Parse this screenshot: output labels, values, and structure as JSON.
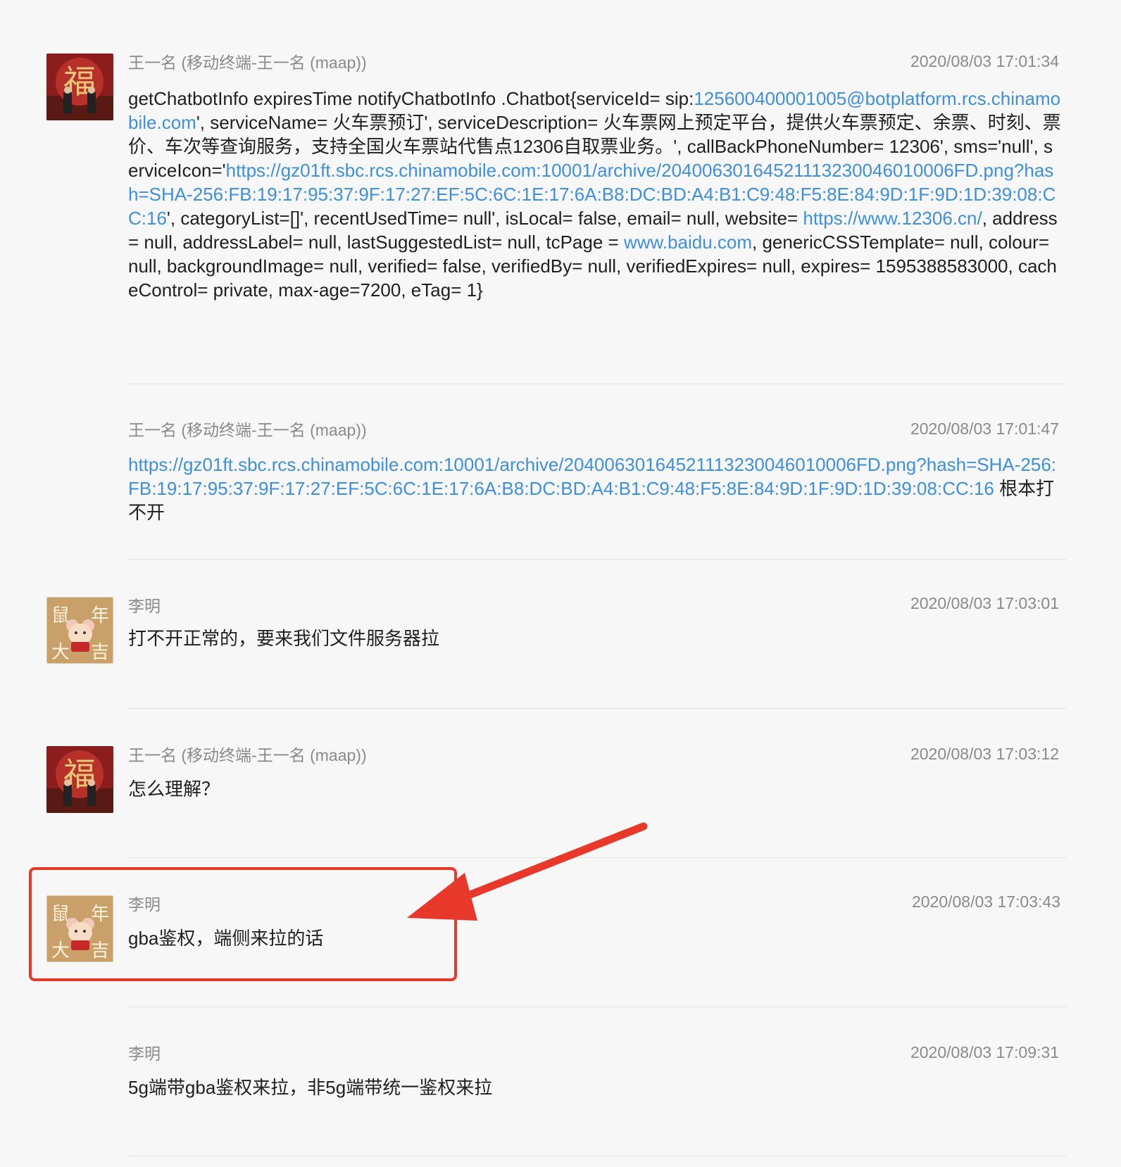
{
  "messages": [
    {
      "sender": "王一名 (移动终端-王一名 (maap))",
      "time": "2020/08/03 17:01:34",
      "avatar": "fu-avatar",
      "segments": [
        {
          "text": " getChatbotInfo  expiresTime notifyChatbotInfo .Chatbot{serviceId= sip:",
          "link": false
        },
        {
          "text": "125600400001005@botplatform.rcs.chinamobile.com",
          "link": true
        },
        {
          "text": "', serviceName= 火车票预订', serviceDescription= 火车票网上预定平台，提供火车票预定、余票、时刻、票价、车次等查询服务，支持全国火车票站代售点12306自取票业务。', callBackPhoneNumber= 12306', sms='null', serviceIcon='",
          "link": false
        },
        {
          "text": "https://gz01ft.sbc.rcs.chinamobile.com:10001/archive/20400630164521113230046010006FD.png?hash=SHA-256:FB:19:17:95:37:9F:17:27:EF:5C:6C:1E:17:6A:B8:DC:BD:A4:B1:C9:48:F5:8E:84:9D:1F:9D:1D:39:08:CC:16",
          "link": true
        },
        {
          "text": "', categoryList=[]', recentUsedTime= null', isLocal= false, email= null, website= ",
          "link": false
        },
        {
          "text": "https://www.12306.cn/",
          "link": true
        },
        {
          "text": ", address= null, addressLabel= null, lastSuggestedList= null, tcPage = ",
          "link": false
        },
        {
          "text": "www.baidu.com",
          "link": true
        },
        {
          "text": ", genericCSSTemplate= null, colour= null, backgroundImage= null, verified= false, verifiedBy= null, verifiedExpires= null, expires= 1595388583000, cacheControl= private, max-age=7200, eTag= 1}",
          "link": false
        }
      ]
    },
    {
      "sender": "王一名 (移动终端-王一名 (maap))",
      "time": "2020/08/03 17:01:47",
      "avatar": "",
      "segments": [
        {
          "text": "https://gz01ft.sbc.rcs.chinamobile.com:10001/archive/20400630164521113230046010006FD.png?hash=SHA-256:FB:19:17:95:37:9F:17:27:EF:5C:6C:1E:17:6A:B8:DC:BD:A4:B1:C9:48:F5:8E:84:9D:1F:9D:1D:39:08:CC:16",
          "link": true
        },
        {
          "text": "  根本打不开",
          "link": false
        }
      ]
    },
    {
      "sender": "李明",
      "time": "2020/08/03 17:03:01",
      "avatar": "mouse-avatar",
      "segments": [
        {
          "text": "打不开正常的，要来我们文件服务器拉",
          "link": false
        }
      ]
    },
    {
      "sender": "王一名 (移动终端-王一名 (maap))",
      "time": "2020/08/03 17:03:12",
      "avatar": "fu-avatar",
      "segments": [
        {
          "text": "怎么理解？",
          "link": false
        }
      ]
    },
    {
      "sender": "李明",
      "time": "2020/08/03 17:03:43",
      "avatar": "mouse-avatar",
      "segments": [
        {
          "text": "gba鉴权，端侧来拉的话",
          "link": false
        }
      ]
    },
    {
      "sender": "李明",
      "time": "2020/08/03 17:09:31",
      "avatar": "",
      "segments": [
        {
          "text": "5g端带gba鉴权来拉，非5g端带统一鉴权来拉",
          "link": false
        }
      ]
    }
  ],
  "avatars": {
    "fu": {
      "glyph": "福",
      "bg": "#8c1d1d"
    },
    "mouse": {
      "glyphs": [
        "鼠",
        "年",
        "大",
        "吉"
      ],
      "bg": "#c9a06a"
    }
  },
  "colors": {
    "link": "#3d8fe0",
    "highlight": "#e8382a",
    "meta": "#8a8a8a",
    "text": "#1f1f1f"
  }
}
